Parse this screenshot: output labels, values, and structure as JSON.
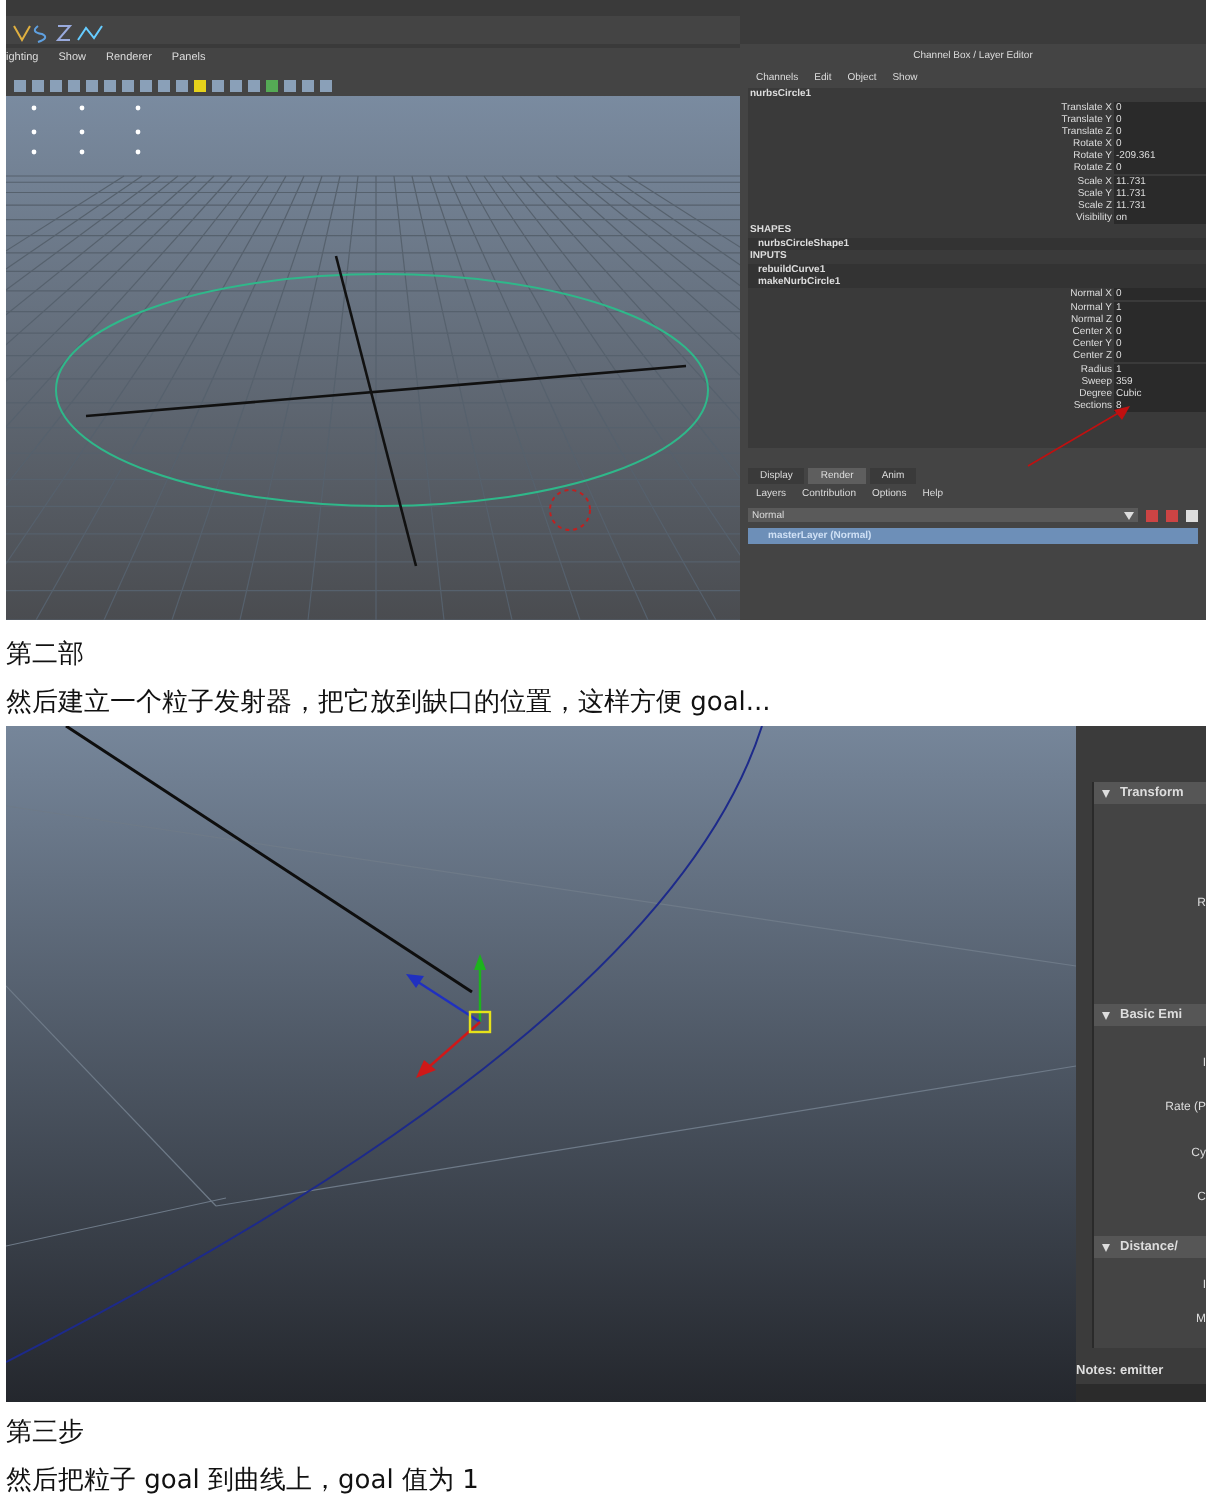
{
  "screenshot_1": {
    "viewport_menu": [
      "ighting",
      "Show",
      "Renderer",
      "Panels"
    ],
    "channel_box": {
      "title": "Channel Box / Layer Editor",
      "menu": [
        "Channels",
        "Edit",
        "Object",
        "Show"
      ],
      "node": "nurbsCircle1",
      "attributes": [
        {
          "label": "Translate X",
          "value": "0"
        },
        {
          "label": "Translate Y",
          "value": "0"
        },
        {
          "label": "Translate Z",
          "value": "0"
        },
        {
          "label": "Rotate X",
          "value": "0"
        },
        {
          "label": "Rotate Y",
          "value": "-209.361"
        },
        {
          "label": "Rotate Z",
          "value": "0"
        },
        {
          "label": "Scale X",
          "value": "11.731"
        },
        {
          "label": "Scale Y",
          "value": "11.731"
        },
        {
          "label": "Scale Z",
          "value": "11.731"
        },
        {
          "label": "Visibility",
          "value": "on"
        }
      ],
      "shapes_heading": "SHAPES",
      "shapes": [
        "nurbsCircleShape1"
      ],
      "inputs_heading": "INPUTS",
      "inputs": [
        "rebuildCurve1",
        "makeNurbCircle1"
      ],
      "input_attributes": [
        {
          "label": "Normal X",
          "value": "0"
        },
        {
          "label": "Normal Y",
          "value": "1"
        },
        {
          "label": "Normal Z",
          "value": "0"
        },
        {
          "label": "Center X",
          "value": "0"
        },
        {
          "label": "Center Y",
          "value": "0"
        },
        {
          "label": "Center Z",
          "value": "0"
        },
        {
          "label": "Radius",
          "value": "1"
        },
        {
          "label": "Sweep",
          "value": "359"
        },
        {
          "label": "Degree",
          "value": "Cubic"
        },
        {
          "label": "Sections",
          "value": "8"
        }
      ]
    },
    "layer_editor": {
      "tabs": [
        {
          "label": "Display",
          "selected": false
        },
        {
          "label": "Render",
          "selected": true
        },
        {
          "label": "Anim",
          "selected": false
        }
      ],
      "menu": [
        "Layers",
        "Contribution",
        "Options",
        "Help"
      ],
      "mode": "Normal",
      "layers": [
        {
          "name": "masterLayer (Normal)",
          "selected": true
        }
      ]
    }
  },
  "step_2": {
    "heading": "第二部",
    "text": "然后建立一个粒子发射器，把它放到缺口的位置，这样方便 goal..."
  },
  "screenshot_2": {
    "sections": [
      {
        "title": "Transform",
        "expanded": true,
        "labels": [
          "R"
        ]
      },
      {
        "title": "Basic Emi",
        "expanded": true,
        "labels": [
          "I",
          "Rate (P",
          "Cy",
          "C"
        ]
      },
      {
        "title": "Distance/",
        "expanded": true,
        "labels": [
          "I",
          "M"
        ]
      }
    ],
    "notes": "Notes: emitter"
  },
  "step_3": {
    "heading": "第三步",
    "text": "然后把粒子 goal 到曲线上，goal 值为 1"
  }
}
